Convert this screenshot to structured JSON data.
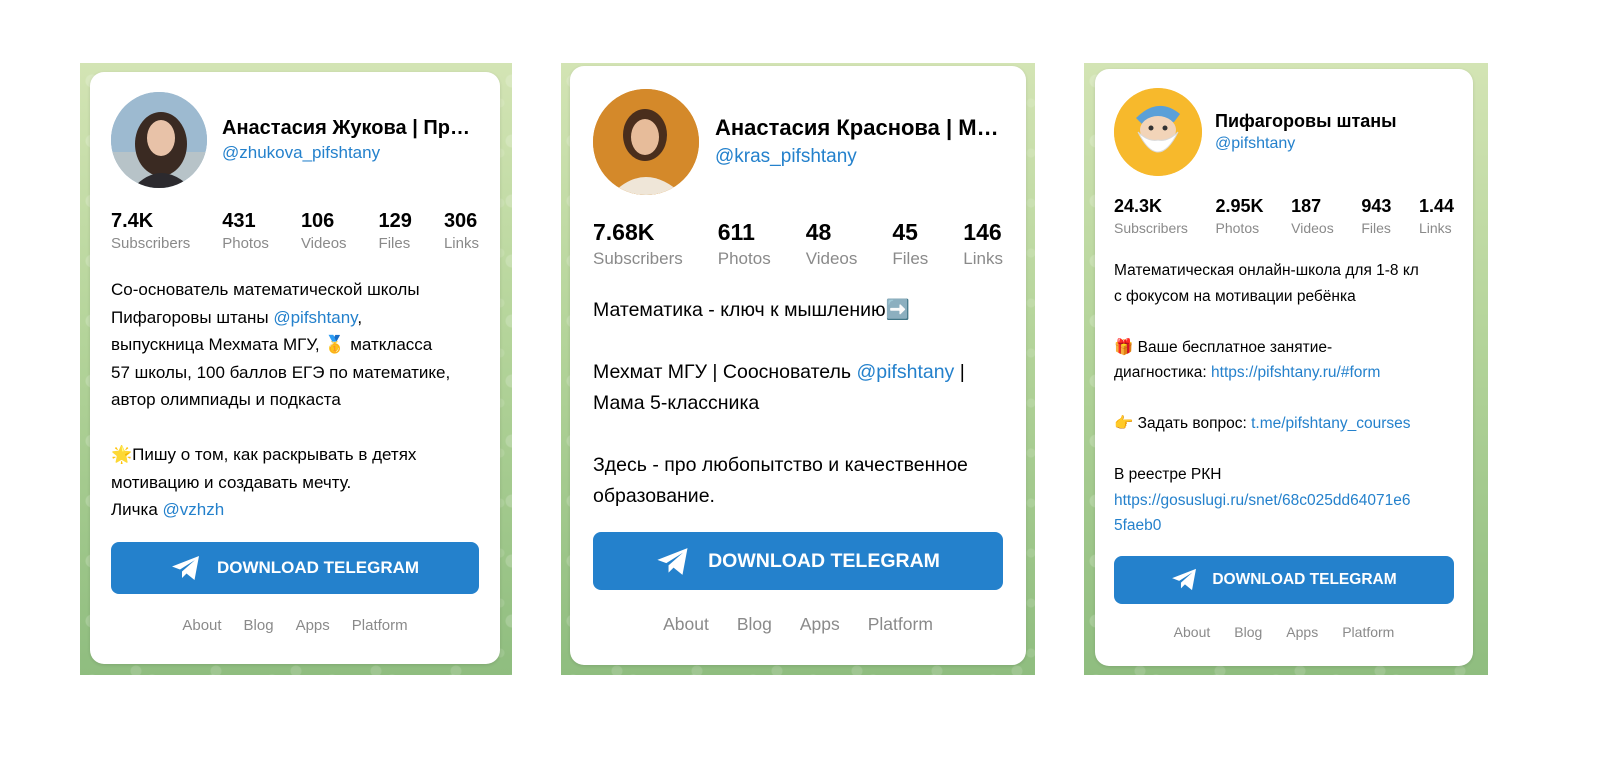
{
  "cards": [
    {
      "name": "Анастасия Жукова | Про…",
      "username": "@zhukova_pifshtany",
      "stats": [
        {
          "value": "7.4K",
          "label": "Subscribers"
        },
        {
          "value": "431",
          "label": "Photos"
        },
        {
          "value": "106",
          "label": "Videos"
        },
        {
          "value": "129",
          "label": "Files"
        },
        {
          "value": "306",
          "label": "Links"
        }
      ],
      "desc": {
        "l1": "Со-основатель математической школы",
        "l2a": "Пифагоровы штаны ",
        "l2link": "@pifshtany",
        "l2b": ",",
        "l3a": "выпускница Мехмата МГУ, ",
        "medal_emoji": "🥇",
        "l3b": " маткласса",
        "l4": "57 школы, 100 баллов ЕГЭ по математике,",
        "l5": "автор олимпиады и подкаста",
        "star_emoji": "🌟",
        "l6": "Пишу о том, как раскрывать в детях",
        "l7": "мотивацию и создавать мечту.",
        "l8a": "Личка ",
        "l8link": "@vzhzh"
      },
      "button": "DOWNLOAD TELEGRAM",
      "footer": [
        "About",
        "Blog",
        "Apps",
        "Platform"
      ]
    },
    {
      "name": "Анастасия Краснова | М…",
      "username": "@kras_pifshtany",
      "stats": [
        {
          "value": "7.68K",
          "label": "Subscribers"
        },
        {
          "value": "611",
          "label": "Photos"
        },
        {
          "value": "48",
          "label": "Videos"
        },
        {
          "value": "45",
          "label": "Files"
        },
        {
          "value": "146",
          "label": "Links"
        }
      ],
      "desc": {
        "l1": "Математика - ключ к мышлению",
        "arrow_emoji": "➡️",
        "l2a": "Мехмат МГУ | Сооснователь ",
        "l2link": "@pifshtany",
        "l2b": " |",
        "l3": "Мама 5-классника",
        "l4": "Здесь - про любопытство и качественное",
        "l5": "образование."
      },
      "button": "DOWNLOAD TELEGRAM",
      "footer": [
        "About",
        "Blog",
        "Apps",
        "Platform"
      ]
    },
    {
      "name": "Пифагоровы штаны",
      "username": "@pifshtany",
      "stats": [
        {
          "value": "24.3K",
          "label": "Subscribers"
        },
        {
          "value": "2.95K",
          "label": "Photos"
        },
        {
          "value": "187",
          "label": "Videos"
        },
        {
          "value": "943",
          "label": "Files"
        },
        {
          "value": "1.44",
          "label": "Links"
        }
      ],
      "desc": {
        "l1": "Математическая онлайн-школа для 1-8 кл",
        "l2": "с фокусом на мотивации ребёнка",
        "gift_emoji": "🎁",
        "l3": " Ваше бесплатное занятие-",
        "l4a": "диагностика: ",
        "l4link": "https://pifshtany.ru/#form",
        "point_emoji": "👉",
        "l5a": " Задать вопрос: ",
        "l5link": "t.me/pifshtany_courses",
        "l6": "В реестре РКН",
        "l7link": "https://gosuslugi.ru/snet/68c025dd64071e6",
        "l8link": "5faeb0"
      },
      "button": "DOWNLOAD TELEGRAM",
      "footer": [
        "About",
        "Blog",
        "Apps",
        "Platform"
      ]
    }
  ]
}
